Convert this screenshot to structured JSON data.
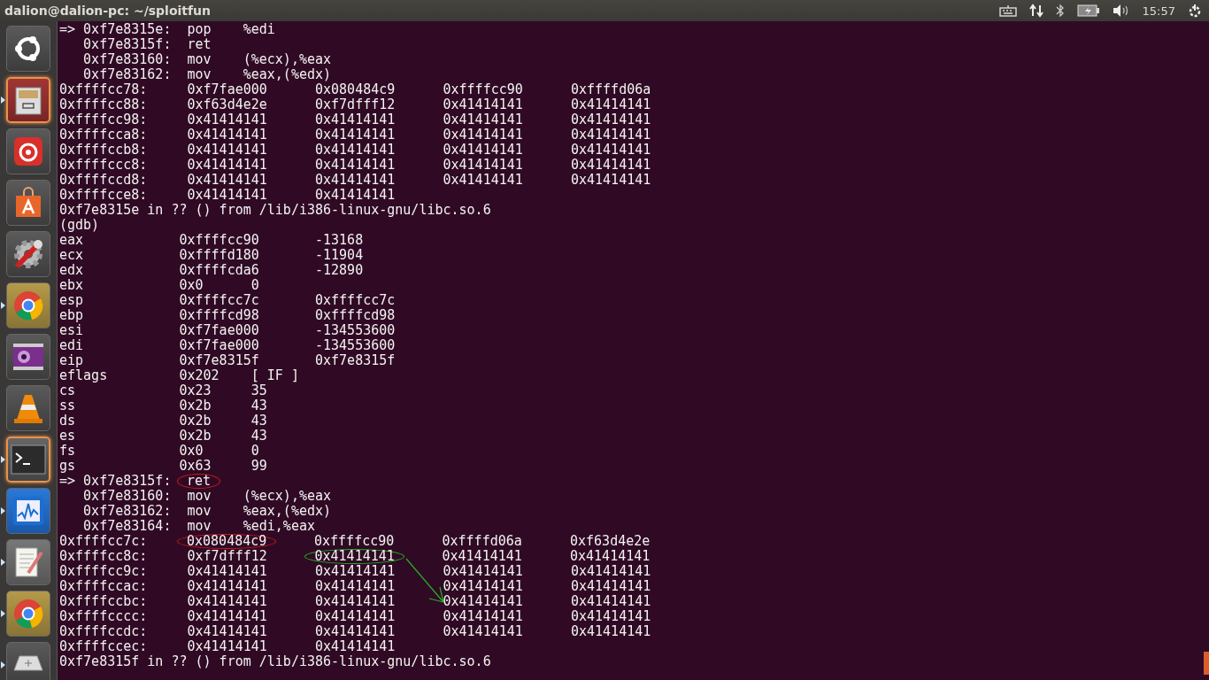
{
  "top_bar": {
    "title": "dalion@dalion-pc: ~/sploitfun",
    "clock": "15:57"
  },
  "launcher": [
    {
      "kind": "ubuntu",
      "selected": false,
      "running": false
    },
    {
      "kind": "files",
      "selected": true,
      "running": true
    },
    {
      "kind": "music",
      "selected": false,
      "running": false
    },
    {
      "kind": "store",
      "selected": false,
      "running": false
    },
    {
      "kind": "settings",
      "selected": false,
      "running": false
    },
    {
      "kind": "chrome",
      "selected": false,
      "running": true
    },
    {
      "kind": "camera",
      "selected": false,
      "running": false
    },
    {
      "kind": "vlc",
      "selected": false,
      "running": false
    },
    {
      "kind": "terminal",
      "selected": true,
      "running": true
    },
    {
      "kind": "monitor",
      "selected": false,
      "running": true
    },
    {
      "kind": "editor",
      "selected": false,
      "running": true
    },
    {
      "kind": "chrome",
      "selected": false,
      "running": true
    },
    {
      "kind": "drive",
      "selected": false,
      "running": true
    }
  ],
  "terminal": {
    "lines": [
      {
        "parts": [
          {
            "text": "=> 0xf7e8315e:  pop    %edi"
          }
        ]
      },
      {
        "parts": [
          {
            "text": "   0xf7e8315f:  ret"
          }
        ]
      },
      {
        "parts": [
          {
            "text": "   0xf7e83160:  mov    (%ecx),%eax"
          }
        ]
      },
      {
        "parts": [
          {
            "text": "   0xf7e83162:  mov    %eax,(%edx)"
          }
        ]
      },
      {
        "parts": [
          {
            "text": "0xffffcc78:     0xf7fae000      0x080484c9      0xffffcc90      0xffffd06a"
          }
        ]
      },
      {
        "parts": [
          {
            "text": "0xffffcc88:     0xf63d4e2e      0xf7dfff12      0x41414141      0x41414141"
          }
        ]
      },
      {
        "parts": [
          {
            "text": "0xffffcc98:     0x41414141      0x41414141      0x41414141      0x41414141"
          }
        ]
      },
      {
        "parts": [
          {
            "text": "0xffffcca8:     0x41414141      0x41414141      0x41414141      0x41414141"
          }
        ]
      },
      {
        "parts": [
          {
            "text": "0xffffccb8:     0x41414141      0x41414141      0x41414141      0x41414141"
          }
        ]
      },
      {
        "parts": [
          {
            "text": "0xffffccc8:     0x41414141      0x41414141      0x41414141      0x41414141"
          }
        ]
      },
      {
        "parts": [
          {
            "text": "0xffffccd8:     0x41414141      0x41414141      0x41414141      0x41414141"
          }
        ]
      },
      {
        "parts": [
          {
            "text": "0xffffcce8:     0x41414141      0x41414141"
          }
        ]
      },
      {
        "parts": [
          {
            "text": "0xf7e8315e in ?? () from /lib/i386-linux-gnu/libc.so.6"
          }
        ]
      },
      {
        "parts": [
          {
            "text": "(gdb)"
          }
        ]
      },
      {
        "parts": [
          {
            "text": "eax            0xffffcc90       -13168"
          }
        ]
      },
      {
        "parts": [
          {
            "text": "ecx            0xffffd180       -11904"
          }
        ]
      },
      {
        "parts": [
          {
            "text": "edx            0xffffcda6       -12890"
          }
        ]
      },
      {
        "parts": [
          {
            "text": "ebx            0x0      0"
          }
        ]
      },
      {
        "parts": [
          {
            "text": "esp            0xffffcc7c       0xffffcc7c"
          }
        ]
      },
      {
        "parts": [
          {
            "text": "ebp            0xffffcd98       0xffffcd98"
          }
        ]
      },
      {
        "parts": [
          {
            "text": "esi            0xf7fae000       -134553600"
          }
        ]
      },
      {
        "parts": [
          {
            "text": "edi            0xf7fae000       -134553600"
          }
        ]
      },
      {
        "parts": [
          {
            "text": "eip            0xf7e8315f       0xf7e8315f"
          }
        ]
      },
      {
        "parts": [
          {
            "text": "eflags         0x202    [ IF ]"
          }
        ]
      },
      {
        "parts": [
          {
            "text": "cs             0x23     35"
          }
        ]
      },
      {
        "parts": [
          {
            "text": "ss             0x2b     43"
          }
        ]
      },
      {
        "parts": [
          {
            "text": "ds             0x2b     43"
          }
        ]
      },
      {
        "parts": [
          {
            "text": "es             0x2b     43"
          }
        ]
      },
      {
        "parts": [
          {
            "text": "fs             0x0      0"
          }
        ]
      },
      {
        "parts": [
          {
            "text": "gs             0x63     99"
          }
        ]
      },
      {
        "parts": [
          {
            "text": "=> 0xf7e8315f:  "
          },
          {
            "text": "ret",
            "color": "#d01818"
          }
        ]
      },
      {
        "parts": [
          {
            "text": "   0xf7e83160:  mov    (%ecx),%eax"
          }
        ]
      },
      {
        "parts": [
          {
            "text": "   0xf7e83162:  mov    %eax,(%edx)"
          }
        ]
      },
      {
        "parts": [
          {
            "text": "   0xf7e83164:  mov    %edi,%eax"
          }
        ]
      },
      {
        "parts": [
          {
            "text": "0xffffcc7c:     "
          },
          {
            "text": "0x080484c9",
            "color": "#d01818"
          },
          {
            "text": "      0xffffcc90      0xffffd06a      0xf63d4e2e"
          }
        ]
      },
      {
        "parts": [
          {
            "text": "0xffffcc8c:     0xf7dfff12      "
          },
          {
            "text": "0x41414141",
            "color": "#22b022"
          },
          {
            "text": "      0x41414141      0x41414141"
          }
        ],
        "arrow": true
      },
      {
        "parts": [
          {
            "text": "0xffffcc9c:     0x41414141      0x41414141      0x41414141      0x41414141"
          }
        ]
      },
      {
        "parts": [
          {
            "text": "0xffffccac:     0x41414141      0x41414141      0x41414141      0x41414141"
          }
        ]
      },
      {
        "parts": [
          {
            "text": "0xffffccbc:     0x41414141      0x41414141      0x41414141      0x41414141"
          }
        ]
      },
      {
        "parts": [
          {
            "text": "0xffffcccc:     0x41414141      0x41414141      0x41414141      0x41414141"
          }
        ]
      },
      {
        "parts": [
          {
            "text": "0xffffccdc:     0x41414141      0x41414141      0x41414141      0x41414141"
          }
        ]
      },
      {
        "parts": [
          {
            "text": "0xffffccec:     0x41414141      0x41414141"
          }
        ]
      },
      {
        "parts": [
          {
            "text": "0xf7e8315f in ?? () from /lib/i386-linux-gnu/libc.so.6"
          }
        ]
      }
    ]
  }
}
